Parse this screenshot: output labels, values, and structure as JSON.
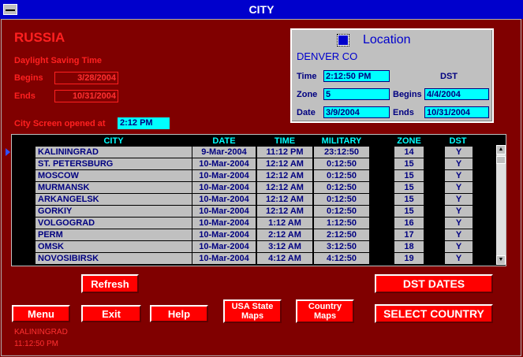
{
  "window": {
    "title": "CITY"
  },
  "country": "RUSSIA",
  "dst": {
    "heading": "Daylight Saving Time",
    "begins_label": "Begins",
    "begins_value": "3/28/2004",
    "ends_label": "Ends",
    "ends_value": "10/31/2004"
  },
  "opened": {
    "label": "City Screen opened at",
    "value": "2:12 PM"
  },
  "location": {
    "title": "Location",
    "city": "DENVER CO",
    "time_label": "Time",
    "time_value": "2:12:50 PM",
    "dst_label": "DST",
    "zone_label": "Zone",
    "zone_value": "5",
    "begins_label": "Begins",
    "begins_value": "4/4/2004",
    "date_label": "Date",
    "date_value": "3/9/2004",
    "ends_label": "Ends",
    "ends_value": "10/31/2004"
  },
  "table": {
    "columns": [
      "CITY",
      "DATE",
      "TIME",
      "MILITARY",
      "ZONE",
      "DST"
    ],
    "rows": [
      [
        "KALININGRAD",
        "9-Mar-2004",
        "11:12 PM",
        "23:12:50",
        "14",
        "Y"
      ],
      [
        "ST. PETERSBURG",
        "10-Mar-2004",
        "12:12 AM",
        "0:12:50",
        "15",
        "Y"
      ],
      [
        "MOSCOW",
        "10-Mar-2004",
        "12:12 AM",
        "0:12:50",
        "15",
        "Y"
      ],
      [
        "MURMANSK",
        "10-Mar-2004",
        "12:12 AM",
        "0:12:50",
        "15",
        "Y"
      ],
      [
        "ARKANGELSK",
        "10-Mar-2004",
        "12:12 AM",
        "0:12:50",
        "15",
        "Y"
      ],
      [
        "GORKIY",
        "10-Mar-2004",
        "12:12 AM",
        "0:12:50",
        "15",
        "Y"
      ],
      [
        "VOLGOGRAD",
        "10-Mar-2004",
        "1:12 AM",
        "1:12:50",
        "16",
        "Y"
      ],
      [
        "PERM",
        "10-Mar-2004",
        "2:12 AM",
        "2:12:50",
        "17",
        "Y"
      ],
      [
        "OMSK",
        "10-Mar-2004",
        "3:12 AM",
        "3:12:50",
        "18",
        "Y"
      ],
      [
        "NOVOSIBIRSK",
        "10-Mar-2004",
        "4:12 AM",
        "4:12:50",
        "19",
        "Y"
      ]
    ]
  },
  "buttons": {
    "refresh": "Refresh",
    "dst_dates": "DST DATES",
    "menu": "Menu",
    "exit": "Exit",
    "help": "Help",
    "usa_state_maps_line1": "USA State",
    "usa_state_maps_line2": "Maps",
    "country_maps_line1": "Country",
    "country_maps_line2": "Maps",
    "select_country": "SELECT COUNTRY"
  },
  "status": {
    "city": "KALININGRAD",
    "time": "11:12:50 PM"
  },
  "colors": {
    "background": "#800000",
    "titlebar": "#0000cc",
    "accent_cyan": "#00ffff",
    "button_red": "#ff0000"
  }
}
